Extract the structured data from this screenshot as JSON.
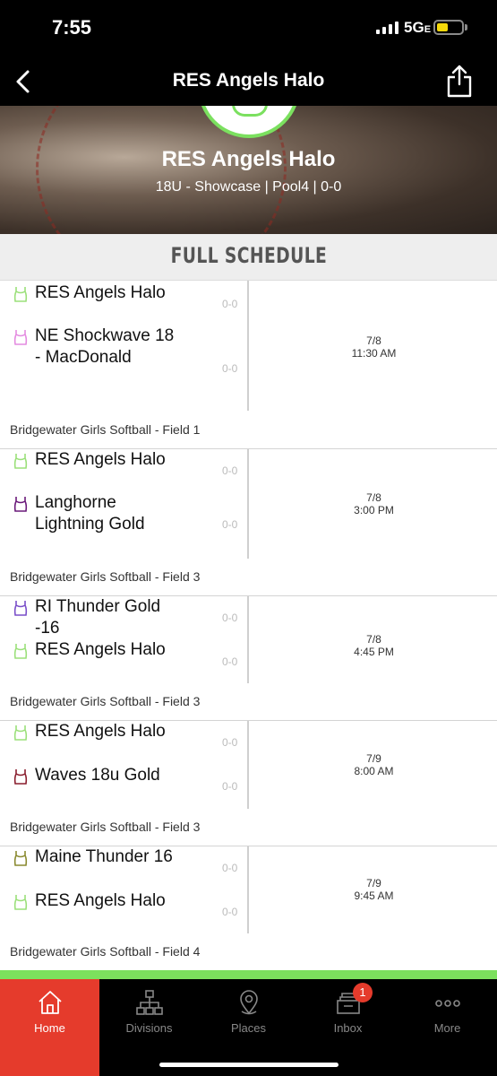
{
  "status_bar": {
    "time": "7:55",
    "network": "5G",
    "network_suffix": "E"
  },
  "nav": {
    "title": "RES Angels Halo"
  },
  "hero": {
    "title": "RES Angels Halo",
    "subtitle": "18U - Showcase | Pool4 | 0-0"
  },
  "section": {
    "title": "FULL SCHEDULE"
  },
  "games": [
    {
      "home": {
        "name": "RES Angels Halo",
        "score": "0-0",
        "jersey_color": "#9be07a"
      },
      "away": {
        "name": "NE Shockwave 18 - MacDonald",
        "score": "0-0",
        "jersey_color": "#e48be0"
      },
      "date": "7/8",
      "time": "11:30 AM",
      "venue": "Bridgewater Girls Softball - Field 1"
    },
    {
      "home": {
        "name": "RES Angels Halo",
        "score": "0-0",
        "jersey_color": "#9be07a"
      },
      "away": {
        "name": "Langhorne Lightning Gold",
        "score": "0-0",
        "jersey_color": "#6a1a7a"
      },
      "date": "7/8",
      "time": "3:00 PM",
      "venue": "Bridgewater Girls Softball - Field 3"
    },
    {
      "home": {
        "name": "RI Thunder Gold -16",
        "score": "0-0",
        "jersey_color": "#7a4fc9"
      },
      "away": {
        "name": "RES Angels Halo",
        "score": "0-0",
        "jersey_color": "#9be07a"
      },
      "date": "7/8",
      "time": "4:45 PM",
      "venue": "Bridgewater Girls Softball - Field 3"
    },
    {
      "home": {
        "name": "RES Angels Halo",
        "score": "0-0",
        "jersey_color": "#9be07a"
      },
      "away": {
        "name": "Waves 18u Gold",
        "score": "0-0",
        "jersey_color": "#8a1e2e"
      },
      "date": "7/9",
      "time": "8:00 AM",
      "venue": "Bridgewater Girls Softball - Field 3"
    },
    {
      "home": {
        "name": "Maine Thunder 16",
        "score": "0-0",
        "jersey_color": "#8a8a30"
      },
      "away": {
        "name": "RES Angels Halo",
        "score": "0-0",
        "jersey_color": "#9be07a"
      },
      "date": "7/9",
      "time": "9:45 AM",
      "venue": "Bridgewater Girls Softball - Field 4"
    }
  ],
  "tabs": [
    {
      "label": "Home",
      "icon": "home-icon",
      "active": true
    },
    {
      "label": "Divisions",
      "icon": "divisions-icon",
      "active": false
    },
    {
      "label": "Places",
      "icon": "location-pin-icon",
      "active": false
    },
    {
      "label": "Inbox",
      "icon": "inbox-icon",
      "active": false,
      "badge": "1"
    },
    {
      "label": "More",
      "icon": "more-icon",
      "active": false
    }
  ],
  "colors": {
    "accent_red": "#e53b2c",
    "brand_green": "#7ce05d"
  }
}
